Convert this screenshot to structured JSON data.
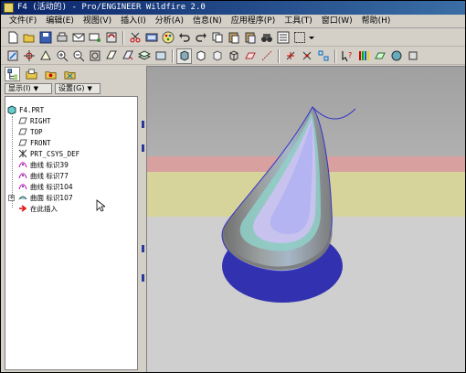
{
  "window": {
    "title": "F4 (活动的) - Pro/ENGINEER Wildfire 2.0"
  },
  "menubar": {
    "items": [
      {
        "label": "文件(F)"
      },
      {
        "label": "编辑(E)"
      },
      {
        "label": "视图(V)"
      },
      {
        "label": "插入(I)"
      },
      {
        "label": "分析(A)"
      },
      {
        "label": "信息(N)"
      },
      {
        "label": "应用程序(P)"
      },
      {
        "label": "工具(T)"
      },
      {
        "label": "窗口(W)"
      },
      {
        "label": "帮助(H)"
      }
    ]
  },
  "model_tree": {
    "display_dropdown": "显示(I)",
    "settings_dropdown": "设置(G)",
    "root": "F4.PRT",
    "items": [
      {
        "label": "RIGHT",
        "icon": "datum-plane-icon"
      },
      {
        "label": "TOP",
        "icon": "datum-plane-icon"
      },
      {
        "label": "FRONT",
        "icon": "datum-plane-icon"
      },
      {
        "label": "PRT_CSYS_DEF",
        "icon": "csys-icon"
      },
      {
        "label": "曲线 标识39",
        "icon": "curve-icon"
      },
      {
        "label": "曲线 标识77",
        "icon": "curve-icon"
      },
      {
        "label": "曲线 标识104",
        "icon": "curve-icon"
      },
      {
        "label": "曲面 标识107",
        "icon": "surface-icon"
      },
      {
        "label": "在此插入",
        "icon": "insert-here-arrow-icon"
      }
    ]
  },
  "colors": {
    "title_bar": "#0a246a",
    "viewport_sky": "#a8a8a8",
    "band_pink": "#d9a0a0",
    "band_yellow": "#d6d49a",
    "floor": "#cfcfcf",
    "model_edge": "#3434c8"
  }
}
